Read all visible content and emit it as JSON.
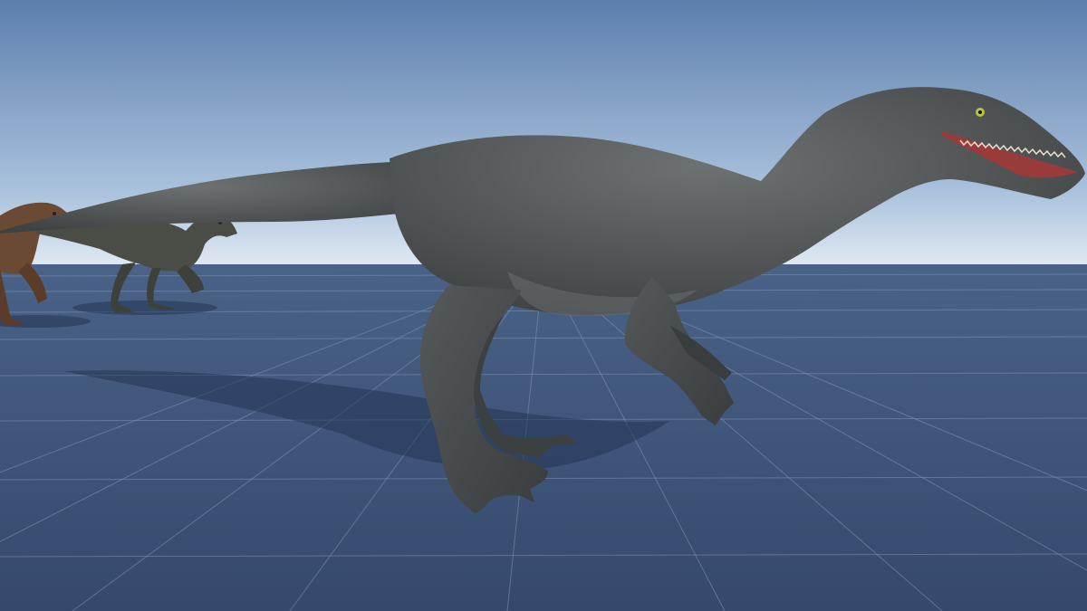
{
  "scene": {
    "sky_top_color": "#5d7fad",
    "sky_horizon_color": "#dfe9f3",
    "ground_color": "#3a527a",
    "grid_line_color": "#7f93b3",
    "shadow_color": "#233554"
  },
  "creatures": [
    {
      "name": "main-raptor",
      "body_color": "#5a5d5e",
      "belly_color": "#6b6f70",
      "eye_color": "#b8c43a",
      "mouth_color": "#9a3b3b"
    },
    {
      "name": "mid-raptor",
      "body_color": "#4a4d45"
    },
    {
      "name": "brown-raptor",
      "body_color": "#6b4a33"
    }
  ]
}
